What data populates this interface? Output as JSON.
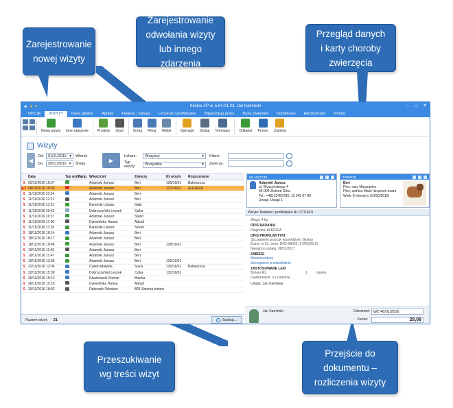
{
  "callouts": {
    "new_visit": "Zarejestrowanie\nnowej wizyty",
    "cancel": "Zarejestrowanie\nodwołania wizyty\nlub innego zdarzenia",
    "review": "Przegląd danych\ni karty choroby\nzwierzęcia",
    "search": "Przeszukiwanie\nwg treści wizyt",
    "document": "Przejście do\ndokumentu –\nrozliczenia wizyty"
  },
  "app": {
    "title": "Klinika XP w. 5.04.01.03, Jan Kamiński",
    "menu": [
      "OPCJE",
      "WIZYTY",
      "Dane główne",
      "Apteka",
      "Finanse / zakupy",
      "Leczenie i profilaktyka",
      "Organizacja pracy",
      "Duże zwierzęta",
      "Dodatkowe",
      "Administrator",
      "Pomoc"
    ],
    "ribbon": [
      {
        "label": "Nowa wizyta",
        "color": "#3a9a3a"
      },
      {
        "label": "Inne zdarzenie",
        "color": "#3b78c4"
      },
      {
        "label": "Przejmij",
        "color": "#5aa03a"
      },
      {
        "label": "Usuń",
        "color": "#555555"
      },
      {
        "label": "Sortuj",
        "color": "#4a7ab5"
      },
      {
        "label": "Filtruj",
        "color": "#4a7ab5"
      },
      {
        "label": "Widok",
        "color": "#6a88aa"
      },
      {
        "label": "Operacje",
        "color": "#e0a020"
      },
      {
        "label": "Drukuj",
        "color": "#5a6c80"
      },
      {
        "label": "Terminarz",
        "color": "#4a6a90"
      },
      {
        "label": "Odśwież",
        "color": "#3a9a3a"
      },
      {
        "label": "Pomoc",
        "color": "#2e6db5"
      },
      {
        "label": "Zamknij",
        "color": "#e0a020"
      }
    ]
  },
  "header": {
    "title": "Wizyty",
    "od_label": "Od:",
    "od_value": "01/11/2016",
    "od_day": "Wtorek",
    "do_label": "Do:",
    "do_value": "30/11/2016",
    "do_day": "Środa",
    "lekarz_label": "Lekarz:",
    "lekarz_value": "Wszyscy",
    "typ_label": "Typ wizyty:",
    "typ_value": "Wszystkie",
    "klient_label": "Klient:",
    "zwierze_label": "Zwierzę:"
  },
  "grid": {
    "columns": [
      "Data",
      "Typ wizyty",
      "Temp.",
      "Właściciel",
      "Zwierzę",
      "Nr wizyty",
      "Rozpoznanie"
    ],
    "rows": [
      [
        "02/11/2016 18:57",
        "Adamski Janusz",
        "Beri",
        "126/16/01",
        "Babeszoza",
        "#3a9a3a",
        false
      ],
      [
        "08/11/2016 15:33",
        "Adamski Janusz",
        "Beri",
        "127/16/01",
        "ALERGIA",
        "#d33",
        true
      ],
      [
        "11/11/2016 10:24",
        "Adamski Janusz",
        "Beri",
        "",
        "",
        "#3b78c4",
        false
      ],
      [
        "11/11/2016 12:21",
        "Adamski Janusz",
        "Beri",
        "",
        "",
        "#555555",
        false
      ],
      [
        "11/11/2016 13:31",
        "Barański Łukasz",
        "Gabi",
        "",
        "",
        "#3a9a3a",
        false
      ],
      [
        "11/11/2016 15:43",
        "Dobroczyński Leszek",
        "Czika",
        "",
        "",
        "#8aa4c0",
        false
      ],
      [
        "11/11/2016 16:37",
        "Adamski Janusz",
        "Stado",
        "",
        "",
        "#3a9a3a",
        false
      ],
      [
        "11/11/2016 17:00",
        "Dziewińska Hanna",
        "Abba2",
        "",
        "",
        "#555555",
        false
      ],
      [
        "11/11/2016 17:26",
        "Barański Łukasz",
        "Szank",
        "",
        "",
        "#3a9a3a",
        false
      ],
      [
        "18/11/2016 18:14",
        "Adamski Janusz",
        "Beri",
        "",
        "",
        "#3b78c4",
        false
      ],
      [
        "18/11/2016 18:17",
        "Adamski Janusz",
        "Beri",
        "",
        "",
        "#3a9a3a",
        false
      ],
      [
        "18/11/2016 18:48",
        "Adamski Janusz",
        "Beri",
        "128/16/01",
        "",
        "#3a9a3a",
        false
      ],
      [
        "19/11/2016 11:45",
        "Adamski Janusz",
        "Beri",
        "",
        "",
        "#555555",
        false
      ],
      [
        "19/11/2016 11:47",
        "Adamski Janusz",
        "Beri",
        "",
        "",
        "#3a9a3a",
        false
      ],
      [
        "19/11/2016 12:56",
        "Adamski Janusz",
        "Beri",
        "129/16/01",
        "",
        "#3a9a3a",
        false
      ],
      [
        "22/11/2016 13:06",
        "Ćwikło Matylda",
        "Suszi",
        "130/16/01",
        "Babeszoza",
        "#3b78c4",
        false
      ],
      [
        "22/11/2016 15:39",
        "Dobroczyński Leszek",
        "Czika",
        "131/16/01",
        "",
        "#3b78c4",
        false
      ],
      [
        "26/11/2016 15:14",
        "Kaczkowski Roman",
        "Bianka",
        "",
        "",
        "#3b78c4",
        false
      ],
      [
        "26/11/2016 15:18",
        "Dziewińska Hanna",
        "Abba2",
        "",
        "",
        "#555555",
        false
      ],
      [
        "26/11/2016 18:02",
        "Dębowski Wiesław",
        "BRI Zwierzę testow",
        "",
        "",
        "#555555",
        false
      ]
    ],
    "count_label": "Razem wizyt:",
    "count": "21",
    "search_label": "Szukaj..."
  },
  "client_card": {
    "header": "WŁAŚCICIEL",
    "name": "Adamski Janusz",
    "street": "ul. Wyszyńskiego 4",
    "city": "66-004 Zielona Góra",
    "tel": "Tel.: +48123456789, 12 345 67 89",
    "notes": "Uwagi: Uwagi 1"
  },
  "animal_card": {
    "header": "ZWIERZĘ",
    "name": "Beri",
    "breed": "Pies: rasy Mieszaniec",
    "sex": "Płeć: samica  Maść: brązowo-szara",
    "age": "Wiek: 8 miesięcy (10/03/2016)"
  },
  "detail": {
    "tab": "Wizyta: Badanie i profilaktyka Nr 127/16/01",
    "waga": "Waga: 4 kg",
    "opis_badania": "OPIS BADANIA",
    "diagnoza": "Diagnoza: ALERGIA",
    "opis_prof": "OPIS PROFILAKTYKI",
    "prof1": "Szczepienie przeciw wściekliźnie: Biokan",
    "prof2": "Zużyt. nr 51, seria: DR2-49002 (17/05/2012)",
    "prof3": "Następny zabieg: 08/11/2017",
    "zabiegi": "ZABIEGI",
    "z1": "Akantocenteza",
    "z2": "Szczepienie p.wściekliźnie",
    "leki": "ZASTOSOWANE LEKI",
    "lek_name": "Biokan R2",
    "lek_qty": "1",
    "lek_unit": "dawka",
    "dawk": "Dawkowanie: 3 x dziennie",
    "lekarz": "Lekarz: Jan Kamiński"
  },
  "footer": {
    "doctor": "Jan Kamiński",
    "dok_label": "Dokument:",
    "dok_value": "WZ 46/01/2016",
    "kwota_label": "Kwota:",
    "kwota_value": "28,08"
  }
}
